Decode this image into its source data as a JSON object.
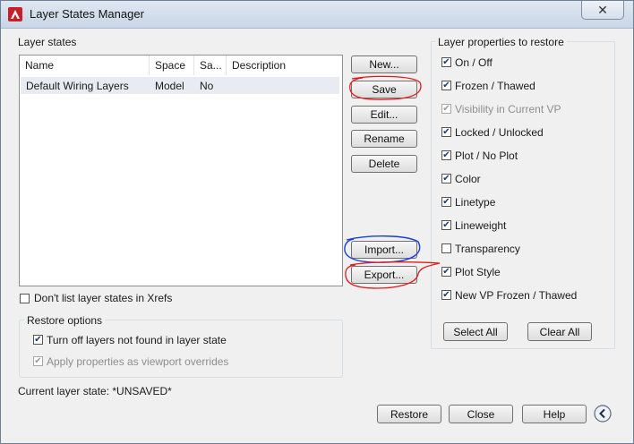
{
  "window": {
    "title": "Layer States Manager",
    "close_glyph": "✕"
  },
  "layer_states": {
    "title": "Layer states",
    "columns": [
      "Name",
      "Space",
      "Sa...",
      "Description"
    ],
    "rows": [
      {
        "name": "Default Wiring Layers",
        "space": "Model",
        "saved": "No",
        "description": ""
      }
    ]
  },
  "buttons": {
    "new": "New...",
    "save": "Save",
    "edit": "Edit...",
    "rename": "Rename",
    "delete": "Delete",
    "import": "Import...",
    "export": "Export...",
    "select_all": "Select All",
    "clear_all": "Clear All",
    "restore": "Restore",
    "close": "Close",
    "help": "Help"
  },
  "dont_list_xrefs": {
    "label": "Don't list layer states in Xrefs",
    "checked": false
  },
  "restore_options": {
    "title": "Restore options",
    "turn_off": {
      "label": "Turn off layers not found in layer state",
      "checked": true
    },
    "apply_overrides": {
      "label": "Apply properties as viewport overrides",
      "checked": true,
      "disabled": true
    }
  },
  "current_state": "Current layer state: *UNSAVED*",
  "properties": {
    "title": "Layer properties to restore",
    "items": [
      {
        "label": "On / Off",
        "checked": true,
        "disabled": false
      },
      {
        "label": "Frozen / Thawed",
        "checked": true,
        "disabled": false
      },
      {
        "label": "Visibility in Current VP",
        "checked": true,
        "disabled": true
      },
      {
        "label": "Locked / Unlocked",
        "checked": true,
        "disabled": false
      },
      {
        "label": "Plot / No Plot",
        "checked": true,
        "disabled": false
      },
      {
        "label": "Color",
        "checked": true,
        "disabled": false
      },
      {
        "label": "Linetype",
        "checked": true,
        "disabled": false
      },
      {
        "label": "Lineweight",
        "checked": true,
        "disabled": false
      },
      {
        "label": "Transparency",
        "checked": false,
        "disabled": false
      },
      {
        "label": "Plot Style",
        "checked": true,
        "disabled": false
      },
      {
        "label": "New VP Frozen / Thawed",
        "checked": true,
        "disabled": false
      }
    ]
  },
  "colors": {
    "annotation_red": "#e31b1b",
    "annotation_blue": "#1c3ee0"
  },
  "icons": {
    "app": "autocad-logo-icon",
    "collapse": "chevron-left-circle-icon"
  }
}
